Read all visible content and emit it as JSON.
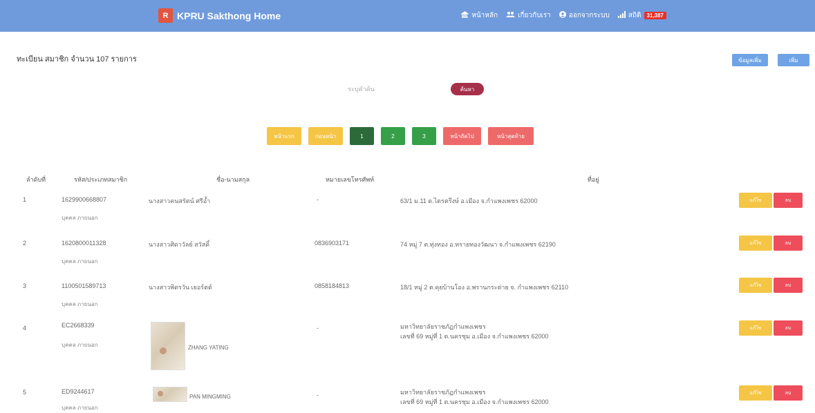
{
  "navbar": {
    "logo_letter": "R",
    "brand": "KPRU Sakthong Home",
    "links": [
      {
        "icon": "home-icon",
        "label": "หน้าหลัก"
      },
      {
        "icon": "users-icon",
        "label": "เกี่ยวกับเรา"
      },
      {
        "icon": "user-circle-icon",
        "label": "ออกจากระบบ"
      }
    ],
    "visits_label": "สถิติ",
    "visits_count": "31,387"
  },
  "page": {
    "title": "ทะเบียน สมาชิก จำนวน 107 รายการ",
    "btn_left": "ข้อมูลเพิ่ม",
    "btn_right": "เพิ่ม"
  },
  "search": {
    "placeholder": "ระบุคำค้น",
    "button": "ค้นหา"
  },
  "pagination": {
    "first": "หน้าแรก",
    "prev": "ก่อนหน้า",
    "pages": [
      "1",
      "2",
      "3"
    ],
    "next": "หน้าถัดไป",
    "last": "หน้าสุดท้าย"
  },
  "table": {
    "headers": [
      "ลำดับที่",
      "รหัส/ประเภทสมาชิก",
      "ชื่อ-นามสกุล",
      "หมายเลขโทรศัพท์",
      "ที่อยู่"
    ],
    "edit_label": "แก้ไข",
    "delete_label": "ลบ",
    "rows": [
      {
        "no": "1",
        "code": "1629900668807",
        "type": "บุคคล ภายนอก",
        "name": "นางสาวคนสรัตน์ ศรีอ้ำ",
        "phone": "-",
        "address": "63/1 ม.11 ต.ไตรตรึงษ์ อ.เมือง จ.กำแพงเพชร 62000",
        "address2": ""
      },
      {
        "no": "2",
        "code": "1620800011328",
        "type": "บุคคล ภายนอก",
        "name": "นางสาวศิดาวัลย์ สวัสดิ์",
        "phone": "0836903171",
        "address": "74 หมู่ 7 ต.ทุ่งทอง อ.ทรายทองวัฒนา จ.กำแพงเพชร 62190",
        "address2": ""
      },
      {
        "no": "3",
        "code": "1100501589713",
        "type": "บุคคล ภายนอก",
        "name": "นางสาวพิตรวัน เยอร์ตต์",
        "phone": "0858184813",
        "address": "18/1 หมู่ 2 ต.คุยบ้านโอง อ.พรานกระต่าย จ. กำแพงเพชร 62110",
        "address2": ""
      },
      {
        "no": "4",
        "code": "EC2668339",
        "type": "บุคคล ภายนอก",
        "name": "ZHANG YATING",
        "phone": "-",
        "address": "มหาวิทยาลัยราชภัฏกำแพงเพชร",
        "address2": "เลขที่ 69 หมู่ที่ 1 ต.นครชุม อ.เมือง จ.กำแพงเพชร 62000"
      },
      {
        "no": "5",
        "code": "ED9244617",
        "type": "บุคคล ภายนอก",
        "name": "PAN MINGMING",
        "phone": "-",
        "address": "มหาวิทยาลัยราชภัฏกำแพงเพชร",
        "address2": "เลขที่ 69 หมู่ที่ 1 ต.นครชุม อ.เมือง จ.กำแพงเพชร 62000"
      }
    ]
  }
}
